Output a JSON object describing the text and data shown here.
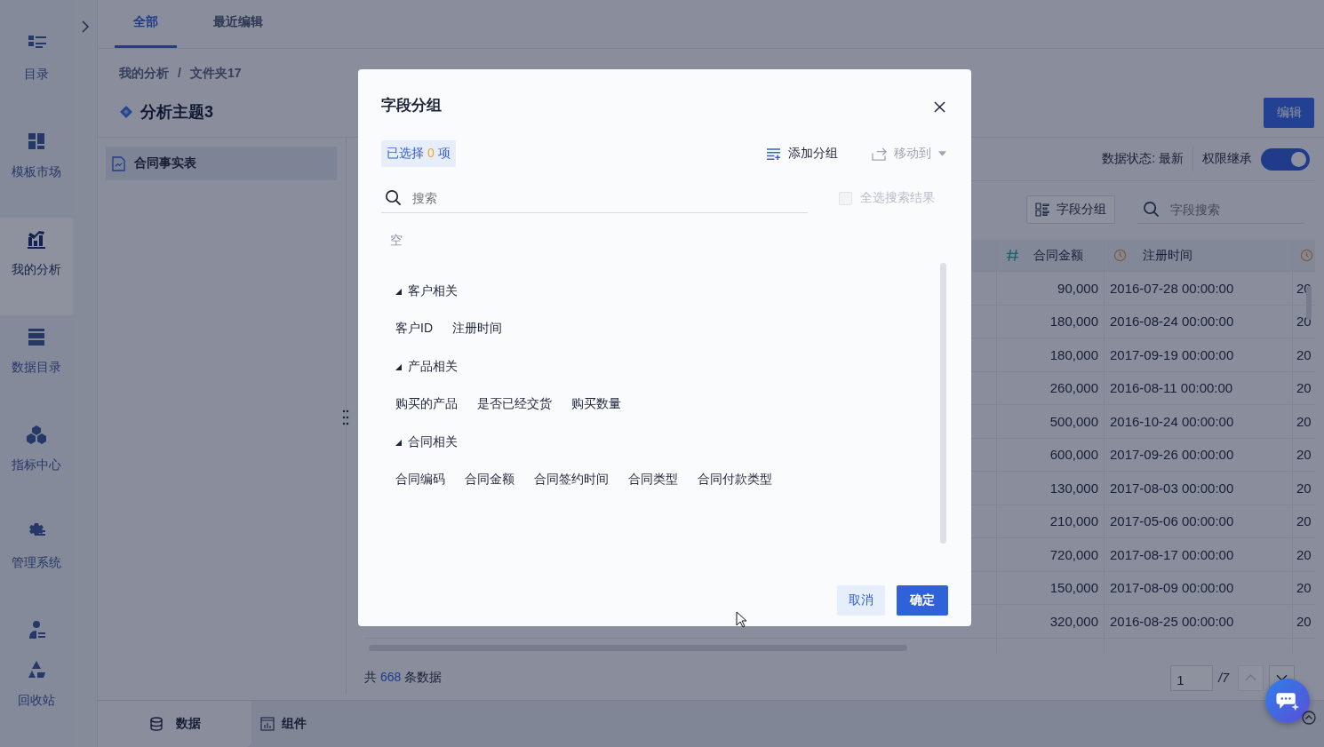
{
  "nav": [
    {
      "label": "目录",
      "selected": false
    },
    {
      "label": "模板市场",
      "selected": false
    },
    {
      "label": "我的分析",
      "selected": true
    },
    {
      "label": "数据目录",
      "selected": false
    },
    {
      "label": "指标中心",
      "selected": false
    },
    {
      "label": "管理系统",
      "selected": false
    },
    {
      "selected": false
    },
    {
      "label": "回收站",
      "selected": false
    }
  ],
  "top_tabs": [
    {
      "label": "全部",
      "selected": true
    },
    {
      "label": "最近编辑",
      "selected": false
    }
  ],
  "breadcrumb": {
    "items": [
      "我的分析",
      "文件夹17"
    ],
    "separator": "/"
  },
  "title": "分析主题3",
  "edit_button": "编辑",
  "tables": [
    {
      "label": "合同事实表",
      "selected": true
    }
  ],
  "status": "数据状态: 最新",
  "permission": {
    "label": "权限继承",
    "on": true
  },
  "toolbar": {
    "group_button": "字段分组",
    "search_placeholder": "字段搜索"
  },
  "table": {
    "columns": [
      {
        "kind": "number",
        "label": "合同金额"
      },
      {
        "kind": "time",
        "label": "注册时间"
      },
      {
        "kind": "time"
      }
    ],
    "rows": [
      [
        "90,000",
        "2016-07-28 00:00:00",
        "20"
      ],
      [
        "180,000",
        "2016-08-24 00:00:00",
        "20"
      ],
      [
        "180,000",
        "2017-09-19 00:00:00",
        "20"
      ],
      [
        "260,000",
        "2016-08-11 00:00:00",
        "20"
      ],
      [
        "500,000",
        "2016-10-24 00:00:00",
        "20"
      ],
      [
        "600,000",
        "2017-09-26 00:00:00",
        "20"
      ],
      [
        "130,000",
        "2017-08-03 00:00:00",
        "20"
      ],
      [
        "210,000",
        "2017-05-06 00:00:00",
        "20"
      ],
      [
        "720,000",
        "2017-08-17 00:00:00",
        "20"
      ],
      [
        "150,000",
        "2017-08-09 00:00:00",
        "20"
      ],
      [
        "320,000",
        "2016-08-25 00:00:00",
        "20"
      ]
    ]
  },
  "footer": {
    "prefix": "共",
    "count": "668",
    "suffix": "条数据"
  },
  "pagination": {
    "page": "1",
    "total": "/7",
    "prev_disabled": true,
    "next_disabled": false
  },
  "bottom_tabs": [
    {
      "label": "数据",
      "selected": true
    },
    {
      "label": "组件",
      "selected": false
    }
  ],
  "dialog": {
    "title": "字段分组",
    "selected_tag": {
      "prefix": "已选择",
      "count": "0",
      "suffix": "项"
    },
    "add_group": "添加分组",
    "move_to": {
      "label": "移动到",
      "disabled": true
    },
    "search": {
      "placeholder": "搜索"
    },
    "select_all": {
      "label": "全选搜索结果",
      "checked": false,
      "disabled": true
    },
    "empty": "空",
    "groups": [
      {
        "name": "客户相关",
        "expanded": true,
        "fields": [
          "客户ID",
          "注册时间"
        ]
      },
      {
        "name": "产品相关",
        "expanded": true,
        "fields": [
          "购买的产品",
          "是否已经交货",
          "购买数量"
        ]
      },
      {
        "name": "合同相关",
        "expanded": true,
        "fields": [
          "合同编码",
          "合同金额",
          "合同签约时间",
          "合同类型",
          "合同付款类型"
        ]
      }
    ],
    "buttons": [
      {
        "label": "取消",
        "kind": "secondary"
      },
      {
        "label": "确定",
        "kind": "primary"
      }
    ]
  }
}
